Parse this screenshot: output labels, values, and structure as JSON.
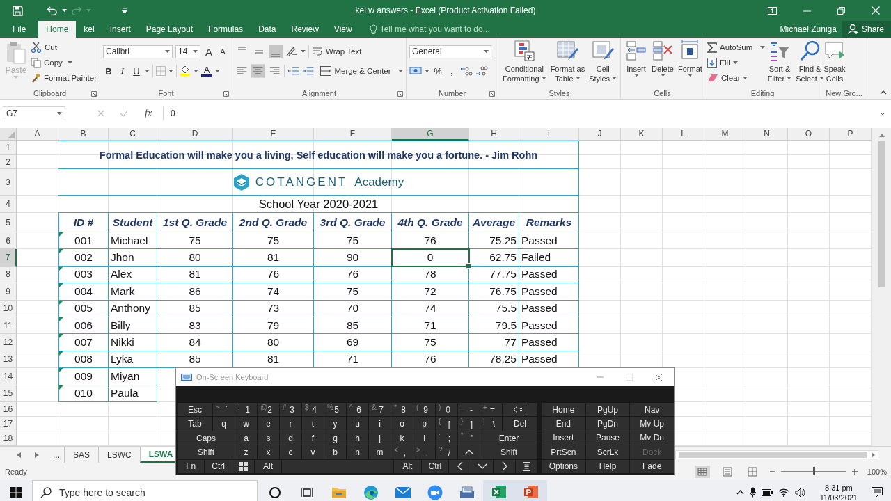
{
  "window": {
    "title": "kel w answers - Excel (Product Activation Failed)"
  },
  "tabs": [
    {
      "label": "File",
      "selected": false
    },
    {
      "label": "Home",
      "selected": true
    },
    {
      "label": "kel",
      "selected": false
    },
    {
      "label": "Insert",
      "selected": false
    },
    {
      "label": "Page Layout",
      "selected": false
    },
    {
      "label": "Formulas",
      "selected": false
    },
    {
      "label": "Data",
      "selected": false
    },
    {
      "label": "Review",
      "selected": false
    },
    {
      "label": "View",
      "selected": false
    }
  ],
  "tell_me": {
    "placeholder": "Tell me what you want to do..."
  },
  "user": {
    "name": "Michael Zuñiga"
  },
  "share": {
    "label": "Share"
  },
  "ribbon": {
    "clipboard": {
      "label": "Clipboard",
      "paste": {
        "label": "Paste",
        "disabled": true
      },
      "cut": "Cut",
      "copy": "Copy",
      "format_painter": "Format Painter"
    },
    "font": {
      "label": "Font",
      "name": "Calibri",
      "size": "14",
      "grow": "A",
      "shrink": "A",
      "bold": "B",
      "italic": "I",
      "underline": "U",
      "font_color": "A"
    },
    "alignment": {
      "label": "Alignment",
      "vertical": [
        {
          "selected": false
        },
        {
          "selected": false
        },
        {
          "selected": true
        }
      ],
      "horizontal": [
        {
          "selected": false
        },
        {
          "selected": true
        },
        {
          "selected": false
        }
      ],
      "wrap_text": "Wrap Text",
      "merge": "Merge & Center"
    },
    "number": {
      "label": "Number",
      "format": "General",
      "percent": "%",
      "comma": ","
    },
    "styles": {
      "label": "Styles",
      "buttons": [
        {
          "kind": "conditional",
          "lines": [
            "Conditional",
            "Formatting"
          ]
        },
        {
          "kind": "table",
          "lines": [
            "Format as",
            "Table"
          ]
        },
        {
          "kind": "cellstyles",
          "lines": [
            "Cell",
            "Styles"
          ]
        }
      ]
    },
    "cells": {
      "label": "Cells",
      "buttons": [
        {
          "kind": "insert",
          "lines": [
            "Insert"
          ]
        },
        {
          "kind": "delete",
          "lines": [
            "Delete"
          ]
        },
        {
          "kind": "format",
          "lines": [
            "Format"
          ]
        }
      ]
    },
    "editing": {
      "label": "Editing",
      "autosum": "AutoSum",
      "fill": "Fill",
      "clear": "Clear",
      "buttons": [
        {
          "kind": "sort",
          "lines": [
            "Sort &",
            "Filter"
          ]
        },
        {
          "kind": "find",
          "lines": [
            "Find &",
            "Select"
          ]
        }
      ]
    },
    "new_group": {
      "label": "New Gro...",
      "buttons": [
        {
          "kind": "speak",
          "lines": [
            "Speak",
            "Cells"
          ]
        }
      ]
    }
  },
  "formula_bar": {
    "name_box": "G7",
    "fx": "fx",
    "value": "0"
  },
  "sheet": {
    "columns": [
      {
        "label": "A",
        "selected": false
      },
      {
        "label": "B",
        "selected": false
      },
      {
        "label": "C",
        "selected": false
      },
      {
        "label": "D",
        "selected": false
      },
      {
        "label": "E",
        "selected": false
      },
      {
        "label": "F",
        "selected": false
      },
      {
        "label": "G",
        "selected": true
      },
      {
        "label": "H",
        "selected": false
      },
      {
        "label": "I",
        "selected": false
      },
      {
        "label": "J",
        "selected": false
      },
      {
        "label": "K",
        "selected": false
      },
      {
        "label": "L",
        "selected": false
      },
      {
        "label": "M",
        "selected": false
      },
      {
        "label": "N",
        "selected": false
      },
      {
        "label": "O",
        "selected": false
      },
      {
        "label": "P",
        "selected": false
      }
    ],
    "rows": [
      {
        "label": "1",
        "selected": false
      },
      {
        "label": "2",
        "selected": false
      },
      {
        "label": "3",
        "selected": false
      },
      {
        "label": "4",
        "selected": false
      },
      {
        "label": "5",
        "selected": false
      },
      {
        "label": "6",
        "selected": false
      },
      {
        "label": "7",
        "selected": true
      },
      {
        "label": "8",
        "selected": false
      },
      {
        "label": "9",
        "selected": false
      },
      {
        "label": "10",
        "selected": false
      },
      {
        "label": "11",
        "selected": false
      },
      {
        "label": "12",
        "selected": false
      },
      {
        "label": "13",
        "selected": false
      },
      {
        "label": "14",
        "selected": false
      },
      {
        "label": "15",
        "selected": false
      },
      {
        "label": "16",
        "selected": false
      },
      {
        "label": "17",
        "selected": false
      },
      {
        "label": "18",
        "selected": false
      }
    ],
    "quote": "Formal Education will make you a living, Self education will make you a fortune. - Jim Rohn",
    "logo": {
      "name": "COTANGENT",
      "suffix": "Academy"
    },
    "school_year": "School Year 2020-2021",
    "table": {
      "columns": [
        "ID #",
        "Student",
        "1st Q. Grade",
        "2nd Q. Grade",
        "3rd Q. Grade",
        "4th Q. Grade",
        "Average",
        "Remarks"
      ],
      "rows": [
        {
          "error_flag": true,
          "cells": [
            "001",
            "Michael",
            "75",
            "75",
            "75",
            "76",
            "75.25",
            "Passed"
          ]
        },
        {
          "error_flag": true,
          "cells": [
            "002",
            "Jhon",
            "80",
            "81",
            "90",
            "0",
            "62.75",
            "Failed"
          ]
        },
        {
          "error_flag": true,
          "cells": [
            "003",
            "Alex",
            "81",
            "76",
            "76",
            "78",
            "77.75",
            "Passed"
          ]
        },
        {
          "error_flag": true,
          "cells": [
            "004",
            "Mark",
            "86",
            "74",
            "75",
            "72",
            "76.75",
            "Passed"
          ]
        },
        {
          "error_flag": true,
          "cells": [
            "005",
            "Anthony",
            "85",
            "73",
            "70",
            "74",
            "75.5",
            "Passed"
          ]
        },
        {
          "error_flag": true,
          "cells": [
            "006",
            "Billy",
            "83",
            "79",
            "85",
            "71",
            "79.5",
            "Passed"
          ]
        },
        {
          "error_flag": true,
          "cells": [
            "007",
            "Nikki",
            "84",
            "80",
            "69",
            "75",
            "77",
            "Passed"
          ]
        },
        {
          "error_flag": true,
          "cells": [
            "008",
            "Lyka",
            "85",
            "81",
            "71",
            "76",
            "78.25",
            "Passed"
          ]
        },
        {
          "error_flag": true,
          "cells": [
            "009",
            "Miyan"
          ]
        },
        {
          "error_flag": true,
          "cells": [
            "010",
            "Paula"
          ]
        }
      ]
    }
  },
  "sheet_tabs": {
    "more": "...",
    "tabs": [
      {
        "label": "SAS",
        "selected": false
      },
      {
        "label": "LSWC",
        "selected": false
      },
      {
        "label": "LSWA",
        "selected": true
      }
    ]
  },
  "status_bar": {
    "text": "Ready",
    "views": [
      {
        "kind": "normal",
        "selected": true
      },
      {
        "kind": "layout",
        "selected": false
      },
      {
        "kind": "pagebreak",
        "selected": false
      }
    ],
    "zoom_slider": {
      "level": 0.5
    },
    "zoom": "100%"
  },
  "keyboard": {
    "title": "On-Screen Keyboard",
    "rows": [
      {
        "keys": [
          {
            "kind": "mod",
            "label": "Esc"
          },
          {
            "kind": "dual",
            "shift": "~",
            "label": "`"
          },
          {
            "kind": "dual",
            "shift": "!",
            "label": "1"
          },
          {
            "kind": "dual",
            "shift": "@",
            "label": "2"
          },
          {
            "kind": "dual",
            "shift": "#",
            "label": "3"
          },
          {
            "kind": "dual",
            "shift": "$",
            "label": "4"
          },
          {
            "kind": "dual",
            "shift": "%",
            "label": "5"
          },
          {
            "kind": "dual",
            "shift": "^",
            "label": "6"
          },
          {
            "kind": "dual",
            "shift": "&",
            "label": "7"
          },
          {
            "kind": "dual",
            "shift": "*",
            "label": "8"
          },
          {
            "kind": "dual",
            "shift": "(",
            "label": "9"
          },
          {
            "kind": "dual",
            "shift": ")",
            "label": "0"
          },
          {
            "kind": "dual",
            "shift": "_",
            "label": "-"
          },
          {
            "kind": "dual",
            "shift": "+",
            "label": "="
          },
          {
            "kind": "backspace"
          }
        ]
      },
      {
        "keys": [
          {
            "kind": "mod",
            "label": "Tab"
          },
          {
            "kind": "key",
            "label": "q"
          },
          {
            "kind": "key",
            "label": "w"
          },
          {
            "kind": "key",
            "label": "e"
          },
          {
            "kind": "key",
            "label": "r"
          },
          {
            "kind": "key",
            "label": "t"
          },
          {
            "kind": "key",
            "label": "y"
          },
          {
            "kind": "key",
            "label": "u"
          },
          {
            "kind": "key",
            "label": "i"
          },
          {
            "kind": "key",
            "label": "o"
          },
          {
            "kind": "key",
            "label": "p"
          },
          {
            "kind": "dual",
            "shift": "{",
            "label": "["
          },
          {
            "kind": "dual",
            "shift": "}",
            "label": "]"
          },
          {
            "kind": "dual",
            "shift": "|",
            "label": "\\"
          },
          {
            "kind": "mod",
            "label": "Del"
          }
        ]
      },
      {
        "keys": [
          {
            "kind": "mod",
            "label": "Caps"
          },
          {
            "kind": "key",
            "label": "a"
          },
          {
            "kind": "key",
            "label": "s"
          },
          {
            "kind": "key",
            "label": "d"
          },
          {
            "kind": "key",
            "label": "f"
          },
          {
            "kind": "key",
            "label": "g"
          },
          {
            "kind": "key",
            "label": "h"
          },
          {
            "kind": "key",
            "label": "j"
          },
          {
            "kind": "key",
            "label": "k"
          },
          {
            "kind": "key",
            "label": "l"
          },
          {
            "kind": "dual",
            "shift": ":",
            "label": ";"
          },
          {
            "kind": "dual",
            "shift": "\"",
            "label": "'"
          },
          {
            "kind": "mod",
            "label": "Enter"
          }
        ]
      },
      {
        "keys": [
          {
            "kind": "mod",
            "label": "Shift"
          },
          {
            "kind": "key",
            "label": "z"
          },
          {
            "kind": "key",
            "label": "x"
          },
          {
            "kind": "key",
            "label": "c"
          },
          {
            "kind": "key",
            "label": "v"
          },
          {
            "kind": "key",
            "label": "b"
          },
          {
            "kind": "key",
            "label": "n"
          },
          {
            "kind": "key",
            "label": "m"
          },
          {
            "kind": "dual",
            "shift": "<",
            "label": ","
          },
          {
            "kind": "dual",
            "shift": ">",
            "label": "."
          },
          {
            "kind": "dual",
            "shift": "?",
            "label": "/"
          },
          {
            "kind": "up"
          },
          {
            "kind": "mod",
            "label": "Shift"
          }
        ]
      },
      {
        "keys": [
          {
            "kind": "mod",
            "label": "Fn"
          },
          {
            "kind": "mod",
            "label": "Ctrl"
          },
          {
            "kind": "windows"
          },
          {
            "kind": "mod",
            "label": "Alt"
          },
          {
            "kind": "space"
          },
          {
            "kind": "mod",
            "label": "Alt"
          },
          {
            "kind": "mod",
            "label": "Ctrl"
          },
          {
            "kind": "left"
          },
          {
            "kind": "down"
          },
          {
            "kind": "right"
          },
          {
            "kind": "menu"
          }
        ]
      }
    ],
    "side": [
      {
        "label": "Home",
        "disabled": false
      },
      {
        "label": "PgUp",
        "disabled": false
      },
      {
        "label": "Nav",
        "disabled": false
      },
      {
        "label": "End",
        "disabled": false
      },
      {
        "label": "PgDn",
        "disabled": false
      },
      {
        "label": "Mv Up",
        "disabled": false
      },
      {
        "label": "Insert",
        "disabled": false
      },
      {
        "label": "Pause",
        "disabled": false
      },
      {
        "label": "Mv Dn",
        "disabled": false
      },
      {
        "label": "PrtScn",
        "disabled": false
      },
      {
        "label": "ScrLk",
        "disabled": false
      },
      {
        "label": "Dock",
        "disabled": true
      },
      {
        "label": "Options",
        "disabled": false
      },
      {
        "label": "Help",
        "disabled": false
      },
      {
        "label": "Fade",
        "disabled": false
      }
    ]
  },
  "taskbar": {
    "search": {
      "placeholder": "Type here to search"
    },
    "apps": [
      {
        "kind": "cortana",
        "running": false
      },
      {
        "kind": "taskview",
        "running": false
      },
      {
        "kind": "explorer",
        "running": false
      },
      {
        "kind": "edge",
        "running": false
      },
      {
        "kind": "mail",
        "running": false
      },
      {
        "kind": "zoom",
        "running": false
      },
      {
        "kind": "scanner",
        "running": false
      },
      {
        "kind": "excel",
        "running": true
      },
      {
        "kind": "powerpoint",
        "running": true
      }
    ],
    "time": "8:31 pm",
    "date": "11/03/2021"
  }
}
